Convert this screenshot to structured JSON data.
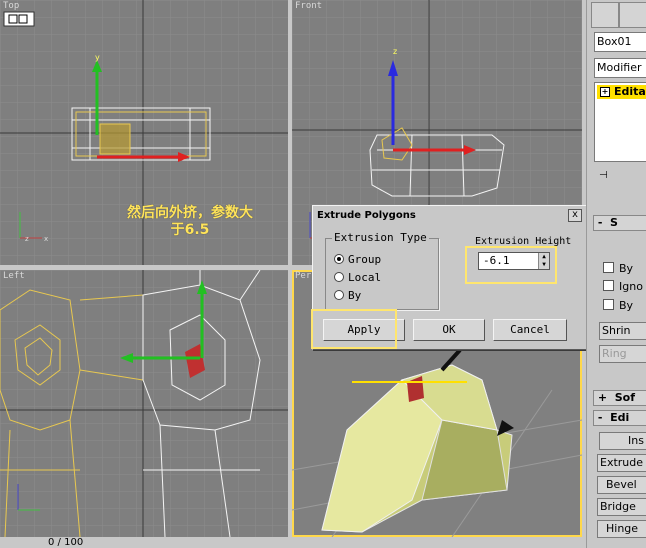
{
  "viewports": {
    "top": {
      "label": "Top"
    },
    "front": {
      "label": "Front"
    },
    "left": {
      "label": "Left"
    },
    "perspective": {
      "label": "Per"
    }
  },
  "annotation": {
    "line1": "然后向外挤，参数大",
    "line2": "于6.5"
  },
  "dialog": {
    "title": "Extrude Polygons",
    "close": "x",
    "group_title": "Extrusion Type",
    "options": [
      "Group",
      "Local",
      "By"
    ],
    "selected_option": "Group",
    "height_label": "Extrusion Height",
    "height_value": "-6.1",
    "apply": "Apply",
    "ok": "OK",
    "cancel": "Cancel"
  },
  "panel": {
    "object_name": "Box01",
    "modifier_list": "Modifier Lis",
    "stack_item": "Edital",
    "checks": [
      "By",
      "Igno",
      "By"
    ],
    "shrink": "Shrin",
    "ring": "Ring",
    "soft_label": "Sof",
    "edit_label": "Edi",
    "buttons": [
      "Ins",
      "Extrude",
      "Bevel",
      "Bridge",
      "Hinge"
    ]
  },
  "status": {
    "frame": "0 / 100"
  },
  "colors": {
    "highlight": "#ffe66e",
    "active_viewport": "#ffd84a",
    "selection": "#ffe000"
  }
}
